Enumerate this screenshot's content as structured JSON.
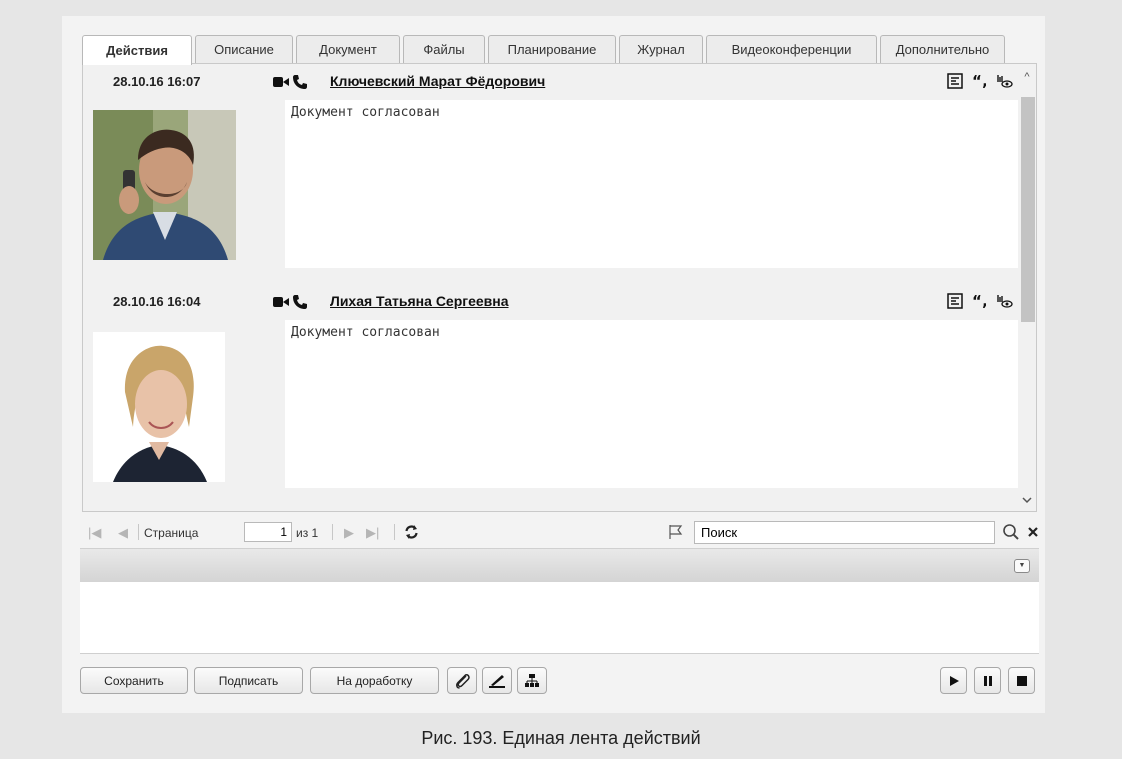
{
  "tabs": [
    "Действия",
    "Описание",
    "Документ",
    "Файлы",
    "Планирование",
    "Журнал",
    "Видеоконференции",
    "Дополнительно"
  ],
  "entries": [
    {
      "date": "28.10.16 16:07",
      "author": "Ключевский Марат Фёдорович",
      "comment": "Документ согласован",
      "photo": "man-avatar"
    },
    {
      "date": "28.10.16 16:04",
      "author": "Лихая Татьяна Сергеевна",
      "comment": "Документ согласован",
      "photo": "woman-avatar"
    }
  ],
  "pager": {
    "page_label": "Страница",
    "page_value": "1",
    "of_label": "из 1"
  },
  "search": {
    "value": "Поиск"
  },
  "buttons": {
    "save": "Сохранить",
    "sign": "Подписать",
    "rework": "На доработку"
  },
  "caption": "Рис. 193. Единая лента действий"
}
